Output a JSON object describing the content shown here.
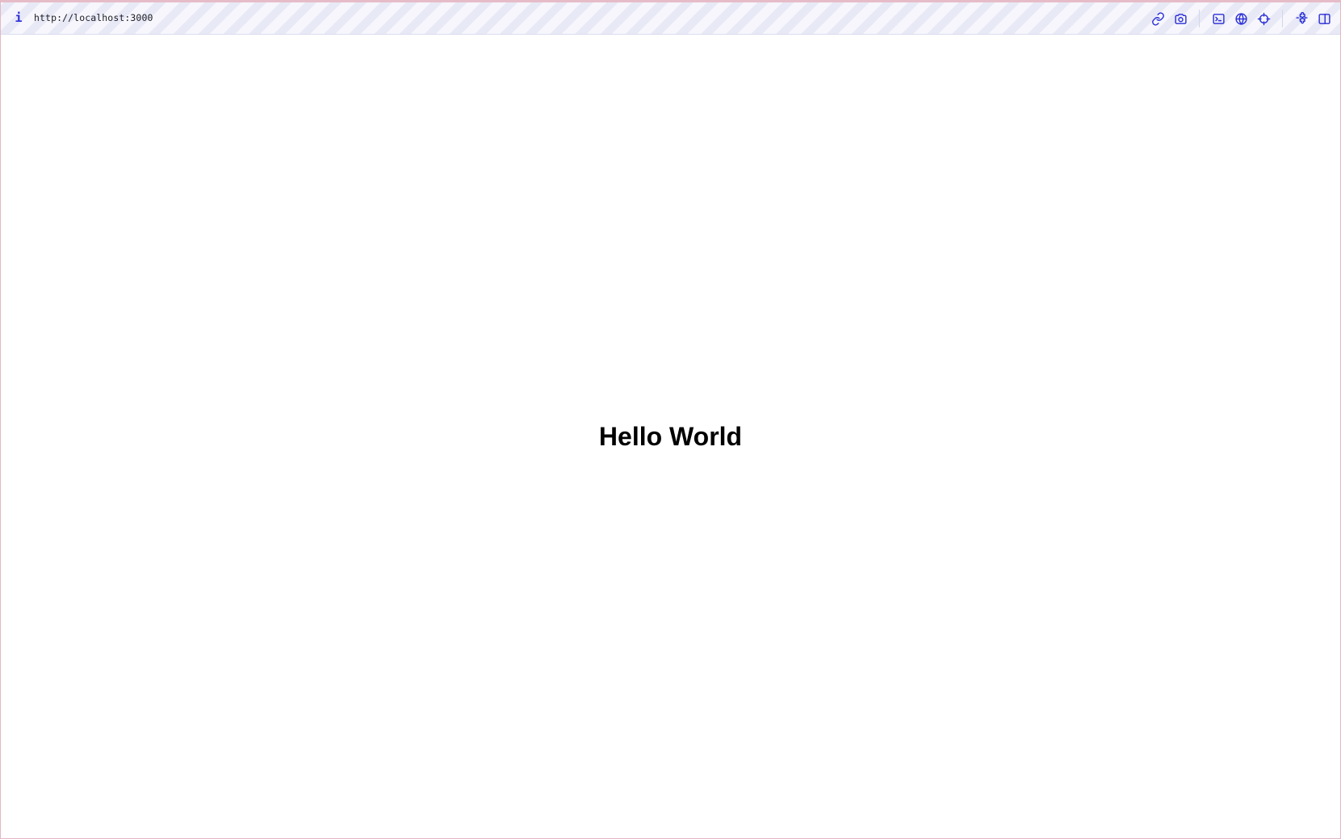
{
  "toolbar": {
    "info_label": "i",
    "url": "http://localhost:3000",
    "icons": [
      "link-icon",
      "camera-icon",
      "terminal-icon",
      "globe-icon",
      "crosshair-icon",
      "puzzle-icon",
      "split-panel-icon"
    ],
    "accent_color": "#2a2fd6"
  },
  "page": {
    "headline": "Hello World"
  }
}
